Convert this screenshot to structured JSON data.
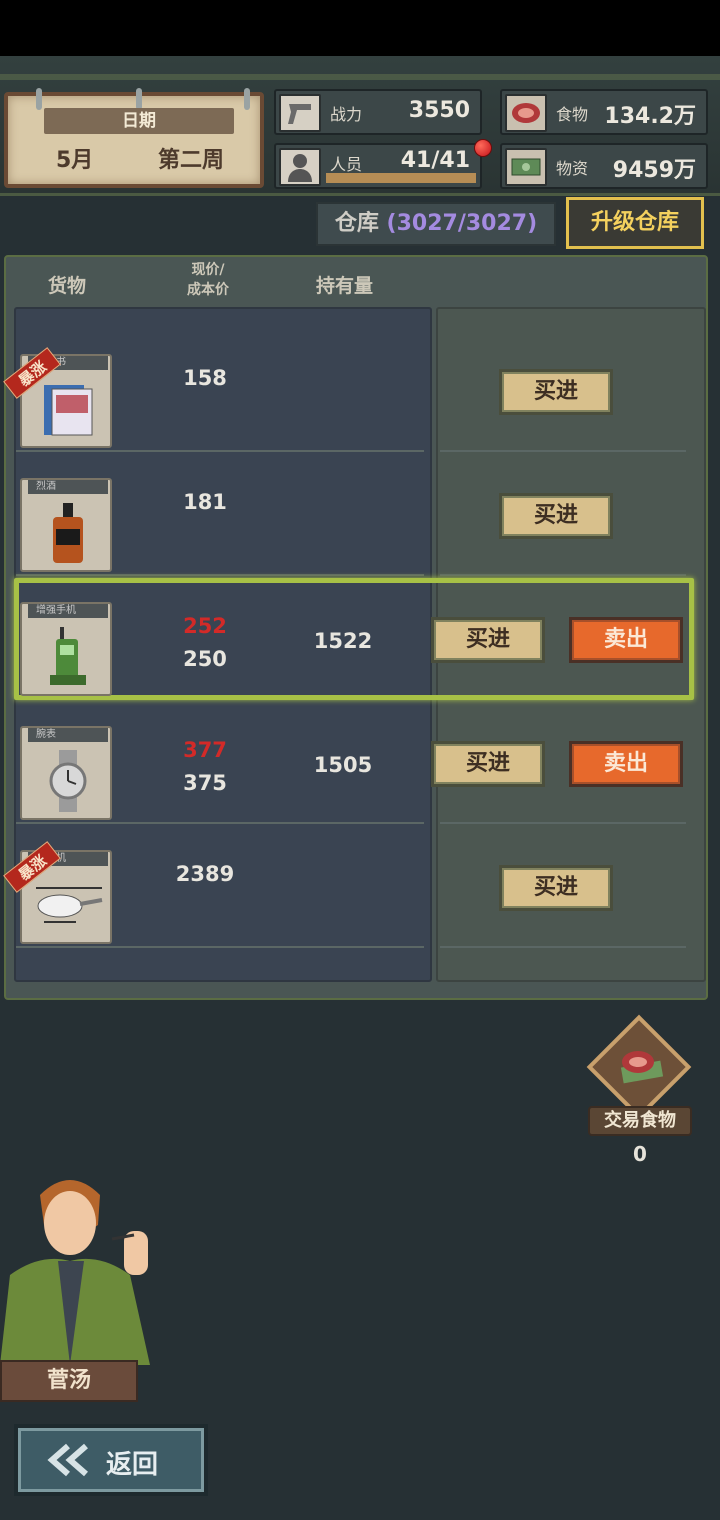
{
  "date": {
    "label": "日期",
    "month": "5月",
    "week": "第二周"
  },
  "stats": {
    "power": {
      "label": "战力",
      "value": "3550",
      "icon": "gun-icon"
    },
    "people": {
      "label": "人员",
      "value": "41/41",
      "icon": "person-icon",
      "fill": 1.0
    },
    "food": {
      "label": "食物",
      "value": "134.2万",
      "icon": "steak-icon"
    },
    "supplies": {
      "label": "物资",
      "value": "9459万",
      "icon": "money-icon"
    }
  },
  "warehouse": {
    "label": "仓库",
    "capacity": "3027/3027",
    "upgrade_label": "升级仓库"
  },
  "table": {
    "headers": {
      "goods": "货物",
      "price_line1": "现价/",
      "price_line2": "成本价",
      "holding": "持有量"
    },
    "rows": [
      {
        "name": "漫画书",
        "surge": "暴涨",
        "price": "158",
        "cost": "",
        "holding": "",
        "buy": "买进",
        "sell": ""
      },
      {
        "name": "烈酒",
        "surge": "",
        "price": "181",
        "cost": "",
        "holding": "",
        "buy": "买进",
        "sell": ""
      },
      {
        "name": "增强手机",
        "surge": "",
        "price": "252",
        "cost": "250",
        "holding": "1522",
        "buy": "买进",
        "sell": "卖出"
      },
      {
        "name": "腕表",
        "surge": "",
        "price": "377",
        "cost": "375",
        "holding": "1505",
        "buy": "买进",
        "sell": "卖出"
      },
      {
        "name": "直升机",
        "surge": "暴涨",
        "price": "2389",
        "cost": "",
        "holding": "",
        "buy": "买进",
        "sell": ""
      }
    ]
  },
  "trade_food": {
    "label": "交易食物",
    "count": "0"
  },
  "character": {
    "name": "菅汤"
  },
  "back_label": "返回",
  "colors": {
    "accent_yellow": "#e2c04e",
    "sell_orange": "#e7692c",
    "price_red": "#d32a28",
    "highlight_green": "#a7c146"
  }
}
